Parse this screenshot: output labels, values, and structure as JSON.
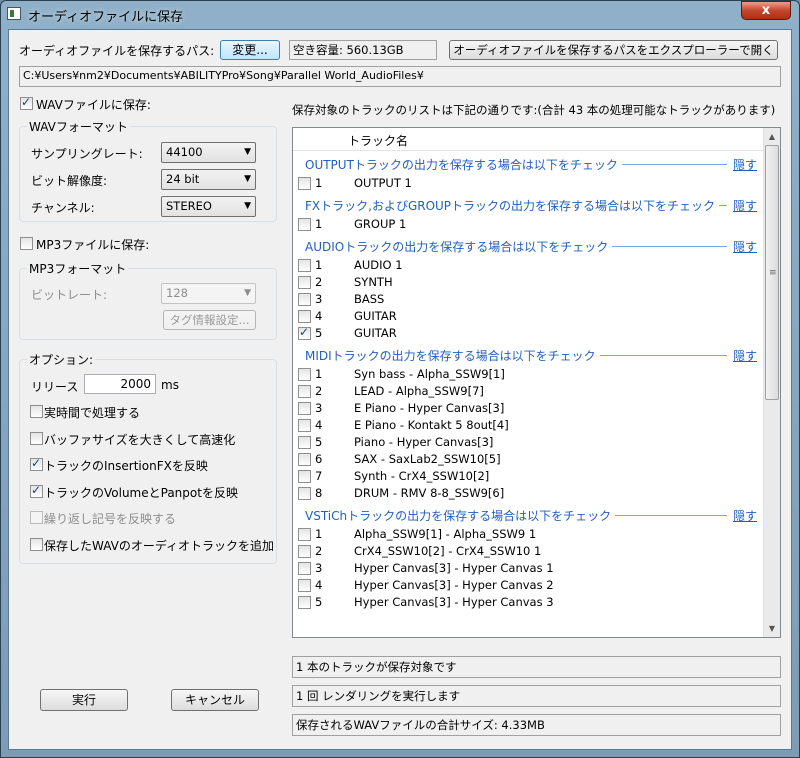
{
  "window": {
    "title": "オーディオファイルに保存",
    "close_label": "x"
  },
  "path": {
    "label": "オーディオファイルを保存するパス:",
    "change_button": "変更...",
    "free_space": "空き容量: 560.13GB",
    "open_explorer_button": "オーディオファイルを保存するパスをエクスプローラーで開く",
    "value": "C:¥Users¥nm2¥Documents¥ABILITYPro¥Song¥Parallel World_AudioFiles¥"
  },
  "wav": {
    "checkbox_label": "WAVファイルに保存:",
    "checked": true,
    "group_title": "WAVフォーマット",
    "samplerate_label": "サンプリングレート:",
    "samplerate_value": "44100",
    "bitdepth_label": "ビット解像度:",
    "bitdepth_value": "24 bit",
    "channel_label": "チャンネル:",
    "channel_value": "STEREO"
  },
  "mp3": {
    "checkbox_label": "MP3ファイルに保存:",
    "checked": false,
    "group_title": "MP3フォーマット",
    "bitrate_label": "ビットレート:",
    "bitrate_value": "128",
    "tag_button": "タグ情報設定..."
  },
  "options": {
    "group_title": "オプション:",
    "release_label": "リリース",
    "release_value": "2000",
    "release_unit": "ms",
    "items": [
      {
        "label": "実時間で処理する",
        "checked": false,
        "disabled": false
      },
      {
        "label": "バッファサイズを大きくして高速化",
        "checked": false,
        "disabled": false
      },
      {
        "label": "トラックのInsertionFXを反映",
        "checked": true,
        "disabled": false
      },
      {
        "label": "トラックのVolumeとPanpotを反映",
        "checked": true,
        "disabled": false
      },
      {
        "label": "繰り返し記号を反映する",
        "checked": false,
        "disabled": true
      },
      {
        "label": "保存したWAVのオーディオトラックを追加",
        "checked": false,
        "disabled": false
      }
    ]
  },
  "tracklist": {
    "caption": "保存対象のトラックのリストは下記の通りです:(合計 43 本の処理可能なトラックがあります)",
    "column_header": "トラック名",
    "hide_label": "隠す",
    "sections": [
      {
        "title": "OUTPUTトラックの出力を保存する場合は以下をチェック",
        "rows": [
          {
            "num": "1",
            "name": "OUTPUT 1",
            "checked": false
          }
        ]
      },
      {
        "title": "FXトラック,およびGROUPトラックの出力を保存する場合は以下をチェック",
        "rows": [
          {
            "num": "1",
            "name": "GROUP 1",
            "checked": false
          }
        ]
      },
      {
        "title": "AUDIOトラックの出力を保存する場合は以下をチェック",
        "rows": [
          {
            "num": "1",
            "name": "AUDIO 1",
            "checked": false
          },
          {
            "num": "2",
            "name": "SYNTH",
            "checked": false
          },
          {
            "num": "3",
            "name": "BASS",
            "checked": false
          },
          {
            "num": "4",
            "name": "GUITAR",
            "checked": false
          },
          {
            "num": "5",
            "name": "GUITAR",
            "checked": true
          }
        ]
      },
      {
        "title": "MIDIトラックの出力を保存する場合は以下をチェック",
        "rows": [
          {
            "num": "1",
            "name": "Syn bass - Alpha_SSW9[1]",
            "checked": false
          },
          {
            "num": "2",
            "name": "LEAD - Alpha_SSW9[7]",
            "checked": false
          },
          {
            "num": "3",
            "name": "E Piano - Hyper Canvas[3]",
            "checked": false
          },
          {
            "num": "4",
            "name": "E Piano - Kontakt 5 8out[4]",
            "checked": false
          },
          {
            "num": "5",
            "name": "Piano - Hyper Canvas[3]",
            "checked": false
          },
          {
            "num": "6",
            "name": "SAX - SaxLab2_SSW10[5]",
            "checked": false
          },
          {
            "num": "7",
            "name": "Synth - CrX4_SSW10[2]",
            "checked": false
          },
          {
            "num": "8",
            "name": "DRUM - RMV 8-8_SSW9[6]",
            "checked": false
          }
        ]
      },
      {
        "title": "VSTiChトラックの出力を保存する場合は以下をチェック",
        "rows": [
          {
            "num": "1",
            "name": "Alpha_SSW9[1] - Alpha_SSW9 1",
            "checked": false
          },
          {
            "num": "2",
            "name": "CrX4_SSW10[2] - CrX4_SSW10 1",
            "checked": false
          },
          {
            "num": "3",
            "name": "Hyper Canvas[3] - Hyper Canvas 1",
            "checked": false
          },
          {
            "num": "4",
            "name": "Hyper Canvas[3] - Hyper Canvas 2",
            "checked": false
          },
          {
            "num": "5",
            "name": "Hyper Canvas[3] - Hyper Canvas 3",
            "checked": false
          }
        ]
      }
    ]
  },
  "status": {
    "tracks": "1 本のトラックが保存対象です",
    "render": "1 回 レンダリングを実行します",
    "size": "保存されるWAVファイルの合計サイズ: 4.33MB"
  },
  "buttons": {
    "execute": "実行",
    "cancel": "キャンセル"
  },
  "scrollbar": {
    "grip_glyph": "≡",
    "up_glyph": "▲",
    "down_glyph": "▼"
  }
}
